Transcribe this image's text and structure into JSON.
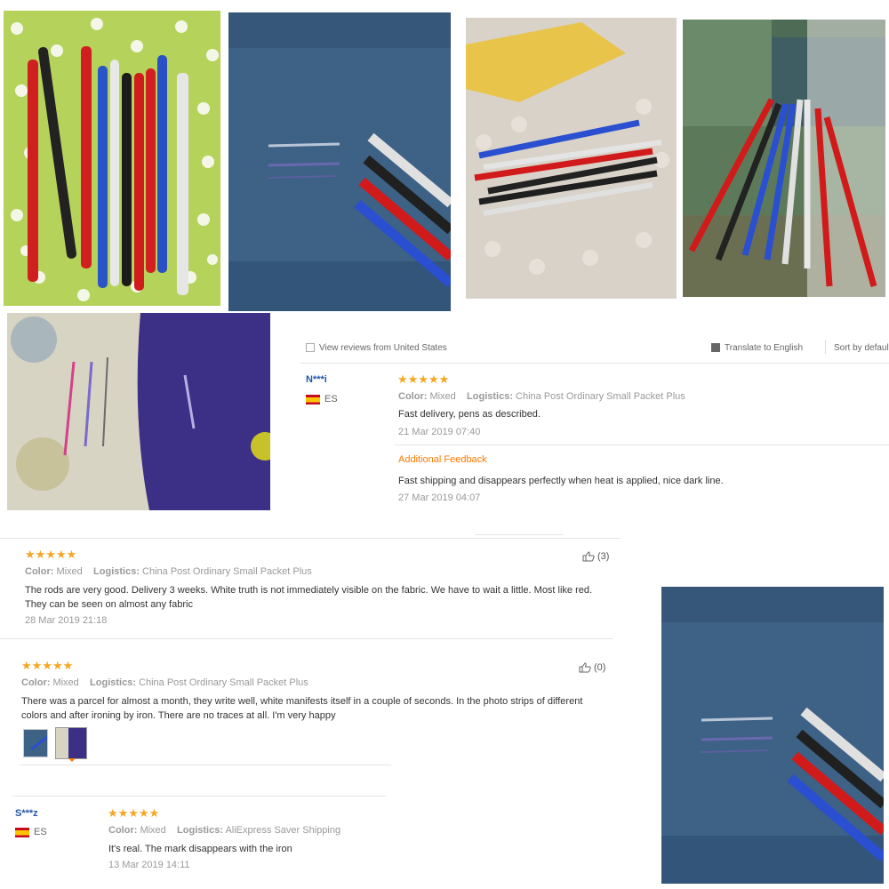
{
  "topbar": {
    "left_label": "View reviews from United States",
    "translate_label": "Translate to English",
    "sort_label": "Sort by default"
  },
  "reviews": [
    {
      "user": "N***i",
      "country": "ES",
      "color_label": "Color:",
      "color_value": "Mixed",
      "logistics_label": "Logistics:",
      "logistics_value": "China Post Ordinary Small Packet Plus",
      "text": "Fast delivery, pens as described.",
      "date": "21 Mar 2019 07:40",
      "additional_label": "Additional Feedback",
      "additional_text": "Fast shipping and disappears perfectly when heat is applied, nice dark line.",
      "additional_date": "27 Mar 2019 04:07"
    },
    {
      "color_label": "Color:",
      "color_value": "Mixed",
      "logistics_label": "Logistics:",
      "logistics_value": "China Post Ordinary Small Packet Plus",
      "text_line1": "The rods are very good. Delivery 3 weeks. White truth is not immediately visible on the fabric. We have to wait a little. Most like red.",
      "text_line2": "They can be seen on almost any fabric",
      "date": "28 Mar 2019 21:18",
      "helpful": "(3)"
    },
    {
      "color_label": "Color:",
      "color_value": "Mixed",
      "logistics_label": "Logistics:",
      "logistics_value": "China Post Ordinary Small Packet Plus",
      "text_line1": "There was a parcel for almost a month, they write well, white manifests itself in a couple of seconds. In the photo strips of different",
      "text_line2": "colors and after ironing by iron. There are no traces at all. I'm very happy",
      "helpful": "(0)"
    },
    {
      "user": "S***z",
      "country": "ES",
      "color_label": "Color:",
      "color_value": "Mixed",
      "logistics_label": "Logistics:",
      "logistics_value": "AliExpress Saver Shipping",
      "text": "It's real. The mark disappears with the iron",
      "date": "13 Mar 2019 14:11"
    }
  ],
  "stars": "★★★★★",
  "colors": {
    "star": "#f5a623",
    "user_link": "#2255aa",
    "additional_feedback": "#ff7a00",
    "fabric_blue": "#3e5f80",
    "pen_red": "#d42020",
    "pen_blue": "#2a4fd0"
  }
}
